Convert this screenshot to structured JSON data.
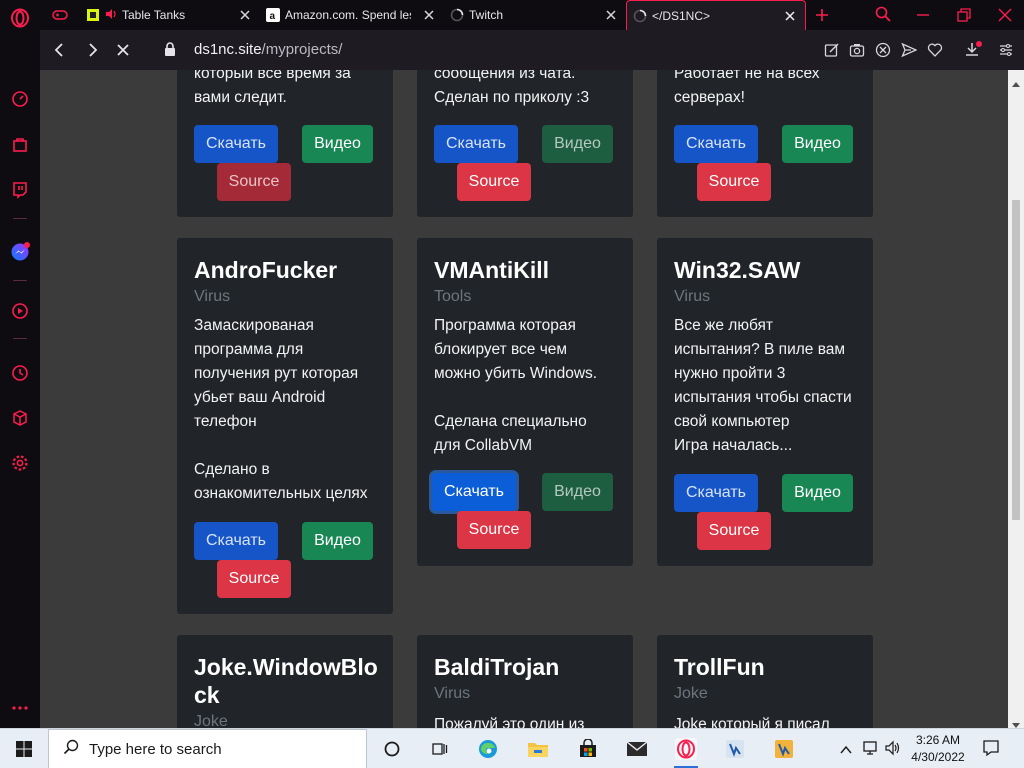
{
  "browser": {
    "tabs": [
      {
        "title": "Table Tanks",
        "icon": "table-tanks-favicon"
      },
      {
        "title": "Amazon.com. Spend less",
        "icon": "amazon-favicon"
      },
      {
        "title": "Twitch",
        "icon": "loading-spinner"
      },
      {
        "title": "</DS1NC>",
        "icon": "loading-spinner"
      }
    ],
    "url_host": "ds1nc.site",
    "url_path": "/myprojects/"
  },
  "projects": [
    {
      "title": "",
      "category": "",
      "text": "который все время за\nвами следит.",
      "download": "Скачать",
      "video": "Видео",
      "source": "Source"
    },
    {
      "title": "",
      "category": "",
      "text": "сообщения из чата.\nСделан по приколу :3",
      "download": "Скачать",
      "video": "Видео",
      "source": "Source"
    },
    {
      "title": "",
      "category": "",
      "text": "Работает не на всех\nсерверах!",
      "download": "Скачать",
      "video": "Видео",
      "source": "Source"
    },
    {
      "title": "AndroFucker",
      "category": "Virus",
      "text": "Замаскированая\nпрограмма для\nполучения рут которая\nубьет ваш Android\nтелефон\n\nСделано в\nознакомительных целях",
      "download": "Скачать",
      "video": "Видео",
      "source": "Source"
    },
    {
      "title": "VMAntiKill",
      "category": "Tools",
      "text": "Программа которая\nблокирует все чем\nможно убить Windows.\n\nСделана специально\nдля CollabVM",
      "download": "Скачать",
      "video": "Видео",
      "source": "Source"
    },
    {
      "title": "Win32.SAW",
      "category": "Virus",
      "text": "Все же любят\nиспытания? В пиле вам\nнужно пройти 3\nиспытания чтобы спасти\nсвой компьютер\nИгра началась...",
      "download": "Скачать",
      "video": "Видео",
      "source": "Source"
    },
    {
      "title": "Joke.WindowBlo\nck",
      "category": "Joke",
      "text": "",
      "download": "",
      "video": "",
      "source": ""
    },
    {
      "title": "BaldiTrojan",
      "category": "Virus",
      "text": "Пожалуй это один из",
      "download": "",
      "video": "",
      "source": ""
    },
    {
      "title": "TrollFun",
      "category": "Joke",
      "text": "Joke который я писал",
      "download": "",
      "video": "",
      "source": ""
    }
  ],
  "taskbar": {
    "search_placeholder": "Type here to search",
    "time": "3:26 AM",
    "date": "4/30/2022"
  },
  "colors": {
    "opera_accent": "#fa1e4e",
    "card_bg": "#212529",
    "page_bg": "#3b3b3c",
    "btn_download": "#0d6efd",
    "btn_video": "#198754",
    "btn_source": "#dc3545"
  }
}
